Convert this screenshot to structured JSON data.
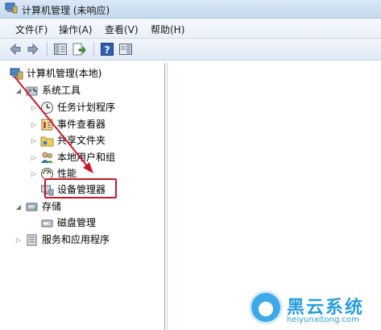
{
  "window": {
    "title": "计算机管理 (未响应)"
  },
  "menu": [
    "文件(F)",
    "操作(A)",
    "查看(V)",
    "帮助(H)"
  ],
  "toolbar": {
    "buttons": [
      "back-icon",
      "forward-icon",
      "show-hide-tree-icon",
      "export-list-icon",
      "help-icon",
      "properties-icon"
    ]
  },
  "tree": [
    {
      "label": "计算机管理(本地)",
      "icon": "computer-management-icon",
      "expanded": true
    },
    {
      "label": "系统工具",
      "icon": "system-tools-icon",
      "expanded": true
    },
    {
      "label": "任务计划程序",
      "icon": "clock-icon",
      "expanded": false
    },
    {
      "label": "事件查看器",
      "icon": "event-viewer-icon",
      "expanded": false
    },
    {
      "label": "共享文件夹",
      "icon": "shared-folder-icon",
      "expanded": false
    },
    {
      "label": "本地用户和组",
      "icon": "users-icon",
      "expanded": false
    },
    {
      "label": "性能",
      "icon": "performance-icon",
      "expanded": false
    },
    {
      "label": "设备管理器",
      "icon": "device-manager-icon",
      "selected_highlight": true
    },
    {
      "label": "存储",
      "icon": "storage-icon",
      "expanded": true
    },
    {
      "label": "磁盘管理",
      "icon": "disk-management-icon"
    },
    {
      "label": "服务和应用程序",
      "icon": "services-icon",
      "expanded": false
    }
  ],
  "colors": {
    "highlight_box": "#c8182b",
    "annotation_arrow": "#c8182b",
    "watermark": "#2a9de0"
  },
  "watermark": {
    "brand": "黑云系统",
    "url": "heiyunxitong.com"
  }
}
